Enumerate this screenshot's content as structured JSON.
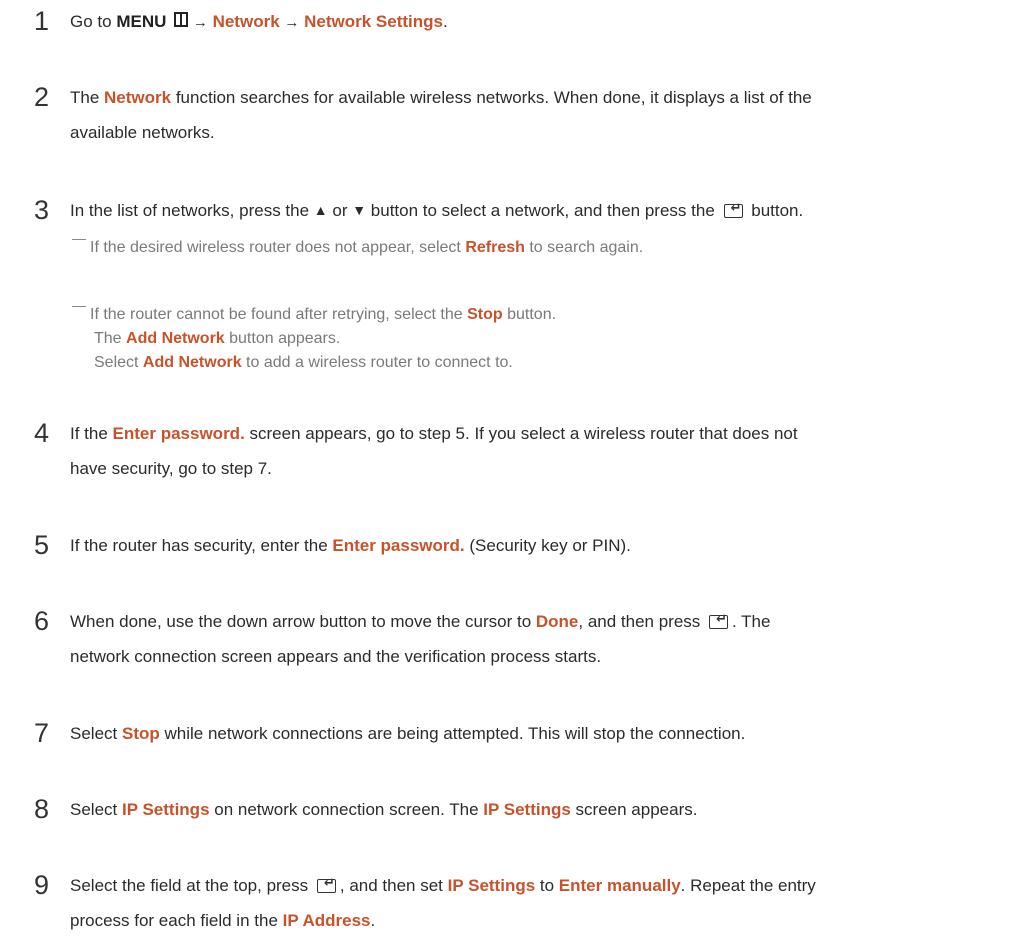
{
  "steps": [
    {
      "number": "1",
      "prefix": "Go to ",
      "menu": "MENU",
      "arrow": "→",
      "network": "Network",
      "network_settings": "Network Settings",
      "period": "."
    },
    {
      "number": "2",
      "before": "The ",
      "network": "Network",
      "line1_after": " function searches for available wireless networks. When done, it displays a list of the",
      "line2": "available networks."
    },
    {
      "number": "3",
      "before": "In the list of networks, press the ",
      "up_triangle": "▲",
      "or": " or ",
      "down_triangle": "▼",
      "after_arrows": " button to select a network, and then press the ",
      "enter_icon": "enter-icon",
      "end": " button."
    },
    {
      "number": "4",
      "before": "If the ",
      "enter_password": "Enter password.",
      "line1_after": " screen appears, go to step 5. If you select a wireless router that does not",
      "line2": "have security, go to step 7."
    },
    {
      "number": "5",
      "before": "If the router has security, enter the ",
      "enter_password": "Enter password.",
      "after": " (Security key or PIN)."
    },
    {
      "number": "6",
      "before": "When done, use the down arrow button to move the cursor to ",
      "done": "Done",
      "after_done": ", and then press ",
      "after_icon": ". The",
      "line2": "network connection screen appears and the verification process starts."
    },
    {
      "number": "7",
      "before": "Select ",
      "stop": "Stop",
      "after": " while network connections are being attempted. This will stop the connection."
    },
    {
      "number": "8",
      "before": "Select ",
      "ip_settings": "IP Settings",
      "middle": " on network connection screen. The ",
      "ip_settings_2": "IP Settings",
      "after": " screen appears."
    },
    {
      "number": "9",
      "before": "Select the field at the top, press ",
      "after_icon": ", and then set ",
      "ip_settings": "IP Settings",
      "to": " to ",
      "enter_manually": "Enter manually",
      "line1_end": ". Repeat the entry",
      "line2_before": "process for each field in the ",
      "ip_address": "IP Address",
      "line2_end": "."
    }
  ],
  "notes": {
    "note1": {
      "before": "If the desired wireless router does not appear, select ",
      "refresh": "Refresh",
      "after": " to search again."
    },
    "note2": {
      "before": "If the router cannot be found after retrying, select the ",
      "stop": "Stop",
      "after": " button.",
      "line2_before": "The ",
      "add_network": "Add Network",
      "line2_after": " button appears.",
      "line3_before": "Select ",
      "add_network_2": "Add Network",
      "line3_after": " to add a wireless router to connect to."
    }
  },
  "colors": {
    "highlight": "#c8532a",
    "text": "#2b2b2b",
    "note_text": "#7a7a7a"
  }
}
